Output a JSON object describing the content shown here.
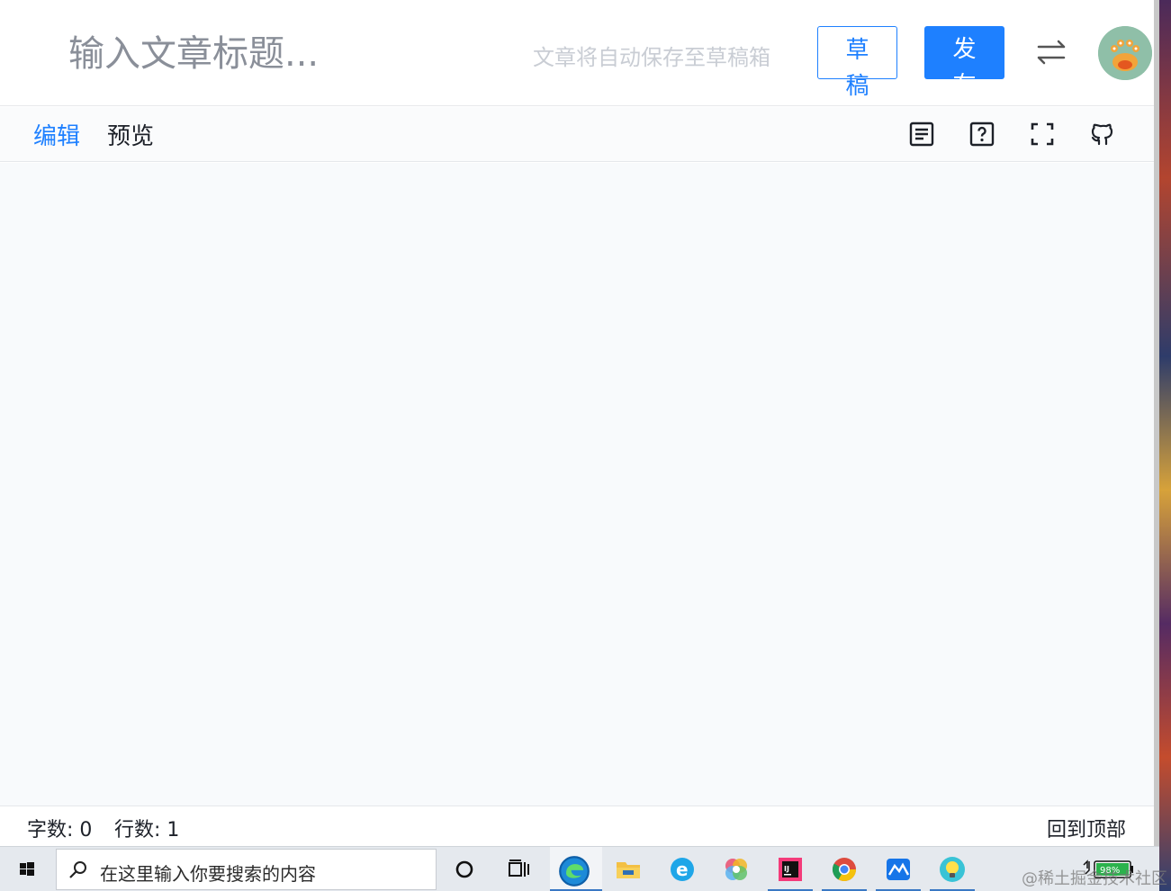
{
  "header": {
    "title_placeholder": "输入文章标题...",
    "autosave_hint": "文章将自动保存至草稿箱",
    "draft_button": "草稿箱",
    "publish_button": "发布"
  },
  "toolbar": {
    "tabs": [
      {
        "label": "编辑",
        "active": true
      },
      {
        "label": "预览",
        "active": false
      }
    ],
    "icons": [
      "table-of-contents-icon",
      "help-icon",
      "fullscreen-icon",
      "github-icon"
    ]
  },
  "status": {
    "word_count": "字数: 0",
    "line_count": "行数: 1",
    "back_to_top": "回到顶部"
  },
  "taskbar": {
    "search_placeholder": "在这里输入你要搜索的内容",
    "battery": "98%",
    "apps": [
      "cortana-icon",
      "task-view-icon",
      "edge-icon",
      "file-explorer-icon",
      "ie-icon",
      "color-app-icon",
      "intellij-icon",
      "chrome-icon",
      "lark-icon",
      "idea-bulb-icon"
    ]
  },
  "watermark": "@稀土掘金技术社区",
  "colors": {
    "accent": "#1e80ff",
    "text": "#1d2129",
    "placeholder": "#8a8f99",
    "hint": "#c9cdd4",
    "editor_bg": "#f8fafc"
  }
}
